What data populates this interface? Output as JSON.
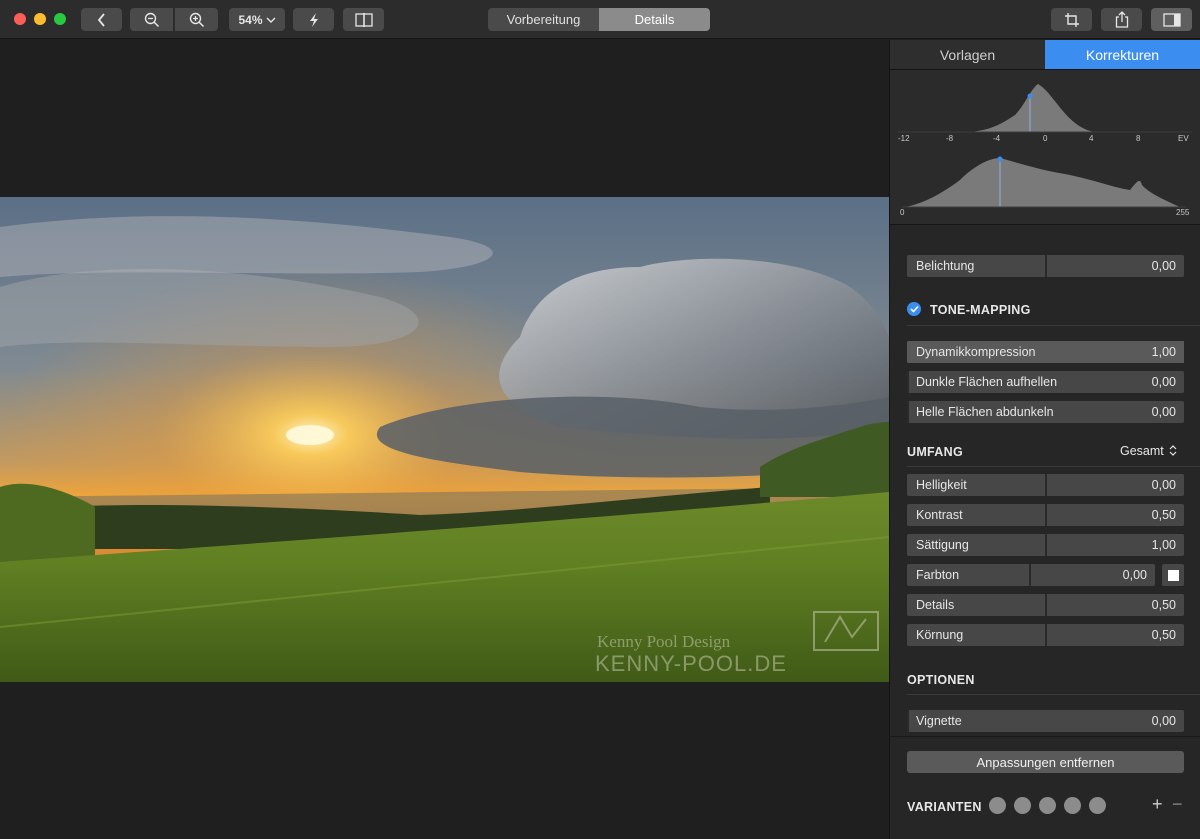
{
  "toolbar": {
    "zoom": "54%",
    "segment": [
      "Vorbereitung",
      "Details"
    ],
    "segment_active": "Details",
    "icons": [
      "back-arrow-icon",
      "zoom-out-icon",
      "zoom-in-icon",
      "flash-icon",
      "compare-split-icon",
      "crop-icon",
      "share-icon",
      "sidebar-toggle-icon"
    ]
  },
  "photo": {
    "watermark_line1": "Kenny Pool Design",
    "watermark_line2": "KENNY-POOL.DE"
  },
  "panel": {
    "tabs": [
      "Vorlagen",
      "Korrekturen"
    ],
    "active_tab": "Korrekturen",
    "histogram": {
      "ev_ticks": [
        "-12",
        "-8",
        "-4",
        "0",
        "4",
        "8",
        "EV"
      ],
      "range_min": "0",
      "range_max": "255"
    },
    "belichtung": {
      "label": "Belichtung",
      "value": "0,00"
    },
    "tone_mapping": {
      "title": "TONE-MAPPING",
      "enabled": true,
      "sliders": [
        {
          "label": "Dynamikkompression",
          "value": "1,00"
        },
        {
          "label": "Dunkle Flächen aufhellen",
          "value": "0,00"
        },
        {
          "label": "Helle Flächen abdunkeln",
          "value": "0,00"
        }
      ]
    },
    "umfang": {
      "title": "UMFANG",
      "selector": "Gesamt",
      "sliders": [
        {
          "label": "Helligkeit",
          "value": "0,00"
        },
        {
          "label": "Kontrast",
          "value": "0,50"
        },
        {
          "label": "Sättigung",
          "value": "1,00"
        },
        {
          "label": "Farbton",
          "value": "0,00"
        },
        {
          "label": "Details",
          "value": "0,50"
        },
        {
          "label": "Körnung",
          "value": "0,50"
        }
      ]
    },
    "optionen": {
      "title": "OPTIONEN",
      "sliders": [
        {
          "label": "Vignette",
          "value": "0,00"
        }
      ]
    },
    "remove_button": "Anpassungen entfernen",
    "variants": {
      "title": "VARIANTEN",
      "add": "+",
      "remove": "−"
    },
    "colors": {
      "accent": "#3b8ef0"
    }
  }
}
